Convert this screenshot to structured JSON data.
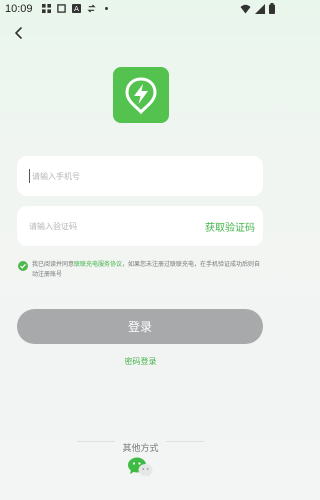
{
  "status_bar": {
    "time": "10:09",
    "icons": [
      "grid-icon",
      "square-icon",
      "a-icon",
      "sync-icon",
      "dot-icon"
    ],
    "right_icons": [
      "wifi-icon",
      "signal-icon",
      "battery-icon"
    ]
  },
  "colors": {
    "accent": "#45b34a",
    "logo_bg": "#53c24f",
    "button_disabled": "#a8a9ab"
  },
  "form": {
    "phone_placeholder": "请输入手机号",
    "code_placeholder": "请输入验证码",
    "get_code_label": "获取验证码"
  },
  "agreement": {
    "prefix": "我已阅读并同意",
    "link": "联联充电服务协议",
    "suffix": "，如果您未注册过联联充电，在手机验证成功后则自动注册账号"
  },
  "login_button": "登录",
  "password_login": "密码登录",
  "other_methods": "其他方式"
}
